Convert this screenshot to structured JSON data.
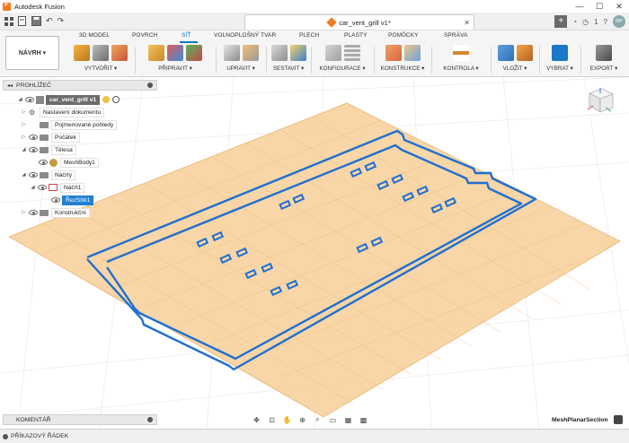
{
  "window": {
    "title": "Autodesk Fusion",
    "controls": [
      "—",
      "☐",
      "✕"
    ]
  },
  "doc_tab": {
    "title": "car_vent_grill v1*",
    "close": "✕"
  },
  "qat_right": {
    "plus": "+",
    "notif_count": "1",
    "avatar": "RP"
  },
  "workspace": {
    "label": "NÁVRH ▾"
  },
  "ribbon_tabs": [
    {
      "label": "3D MODEL"
    },
    {
      "label": "POVRCH"
    },
    {
      "label": "SÍŤ",
      "active": true
    },
    {
      "label": "VOLNOPLOŠNÝ TVAR"
    },
    {
      "label": "PLECH"
    },
    {
      "label": "PLASTY"
    },
    {
      "label": "POMŮCKY"
    },
    {
      "label": "SPRÁVA"
    }
  ],
  "ribbon_groups": [
    {
      "label": "VYTVOŘIT ▾"
    },
    {
      "label": "PŘIPRAVIT ▾"
    },
    {
      "label": "UPRAVIT ▾"
    },
    {
      "label": "SESTAVIT ▾"
    },
    {
      "label": "KONFIGURACE ▾"
    },
    {
      "label": "KONSTRUKCE ▾"
    },
    {
      "label": "KONTROLA ▾"
    },
    {
      "label": "VLOŽIT ▾"
    },
    {
      "label": "VYBRAT ▾"
    },
    {
      "label": "EXPORT ▾"
    }
  ],
  "browser": {
    "title": "PROHLÍŽEČ",
    "nodes": [
      {
        "label": "car_vent_grill v1"
      },
      {
        "label": "Nastavení dokumentu"
      },
      {
        "label": "Pojmenované pohledy"
      },
      {
        "label": "Počátek"
      },
      {
        "label": "Tělesa"
      },
      {
        "label": "MeshBody1"
      },
      {
        "label": "Náčrty"
      },
      {
        "label": "Náčrt1"
      },
      {
        "label": "ŘezSítě1"
      },
      {
        "label": "Konstrukční"
      }
    ]
  },
  "viewcube": {
    "face": "HORNÍ"
  },
  "comments": {
    "label": "KOMENTÁŘ"
  },
  "tool_name": "MeshPlanarSection",
  "command_line": {
    "label": "PŘÍKAZOVÝ ŘÁDEK"
  },
  "colors": {
    "accent": "#0c7ac7",
    "plane": "#f7cf98",
    "outline": "#1f6fd0",
    "selection": "#1f80d1"
  }
}
